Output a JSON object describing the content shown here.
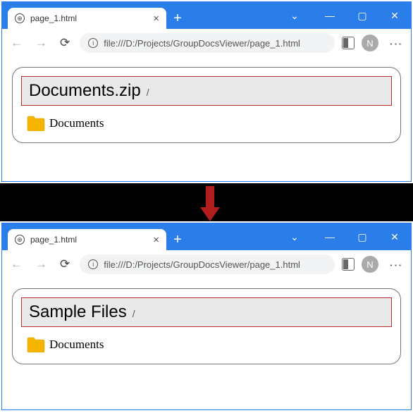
{
  "window1": {
    "tab_title": "page_1.html",
    "url": "file:///D:/Projects/GroupDocsViewer/page_1.html",
    "avatar_letter": "N",
    "breadcrumb_title": "Documents.zip",
    "breadcrumb_sep": "/",
    "folder_name": "Documents"
  },
  "window2": {
    "tab_title": "page_1.html",
    "url": "file:///D:/Projects/GroupDocsViewer/page_1.html",
    "avatar_letter": "N",
    "breadcrumb_title": "Sample Files",
    "breadcrumb_sep": "/",
    "folder_name": "Documents"
  }
}
